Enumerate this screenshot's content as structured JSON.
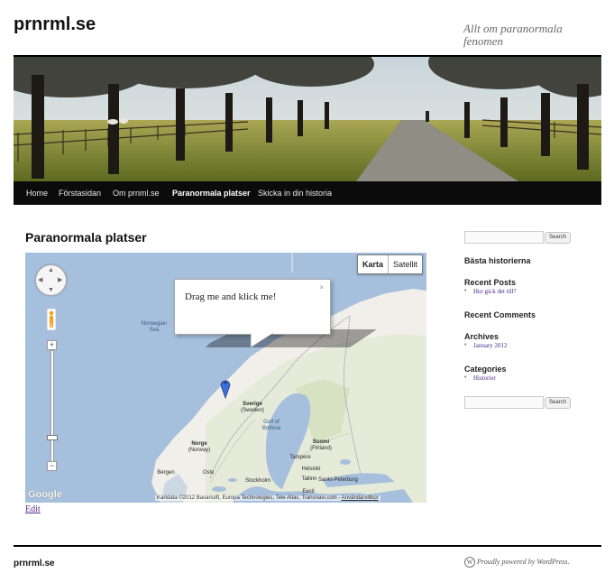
{
  "site": {
    "title": "prnrml.se",
    "description": "Allt om paranormala fenomen"
  },
  "nav": {
    "items": [
      {
        "label": "Home"
      },
      {
        "label": "Förstasidan"
      },
      {
        "label": "Om prnml.se"
      },
      {
        "label": "Paranormala platser",
        "active": true
      },
      {
        "label": "Skicka in din historia"
      }
    ]
  },
  "main": {
    "heading": "Paranormala platser",
    "edit_label": "Edit"
  },
  "map": {
    "types": [
      "Karta",
      "Satellit"
    ],
    "active_type": "Karta",
    "infowindow_text": "Drag me and klick me!",
    "infowindow_close": "×",
    "logo": "Google",
    "attribution": "Kartdata ©2012 Basarsoft, Europa Technologies, Tele Atlas, Transnavi.com - ",
    "terms_link": "Användarvillkor",
    "zoom_in": "+",
    "zoom_out": "−",
    "labels": {
      "norwegian_sea": "Norwegian\nSea",
      "sverige": "Sverige",
      "sverige_en": "(Sweden)",
      "gulf": "Gulf of\nBothnia",
      "suomi": "Suomi",
      "suomi_en": "(Finland)",
      "norge": "Norge",
      "norge_en": "(Norway)",
      "tampere": "Tampere",
      "helsinki": "Helsinki",
      "bergen": "Bergen",
      "oslo": "Oslo",
      "stockholm": "Stockholm",
      "tallinn": "Tallinn",
      "sankt_peterburg": "Sankt-Peterburg",
      "eesti": "Eesti"
    },
    "colors": {
      "water": "#a5bfdd",
      "land": "#f1efe9",
      "forest": "#cddcb2"
    }
  },
  "sidebar": {
    "search_button": "Search",
    "widgets": [
      {
        "title": "Bästa historierna",
        "links": []
      },
      {
        "title": "Recent Posts",
        "links": [
          "Hur gick det till?"
        ]
      },
      {
        "title": "Recent Comments",
        "links": []
      },
      {
        "title": "Archives",
        "links": [
          "January 2012"
        ]
      },
      {
        "title": "Categories",
        "links": [
          "Historier"
        ]
      }
    ]
  },
  "footer": {
    "site_title": "prnrml.se",
    "credit": "Proudly powered by WordPress.",
    "wp_icon": "W"
  }
}
